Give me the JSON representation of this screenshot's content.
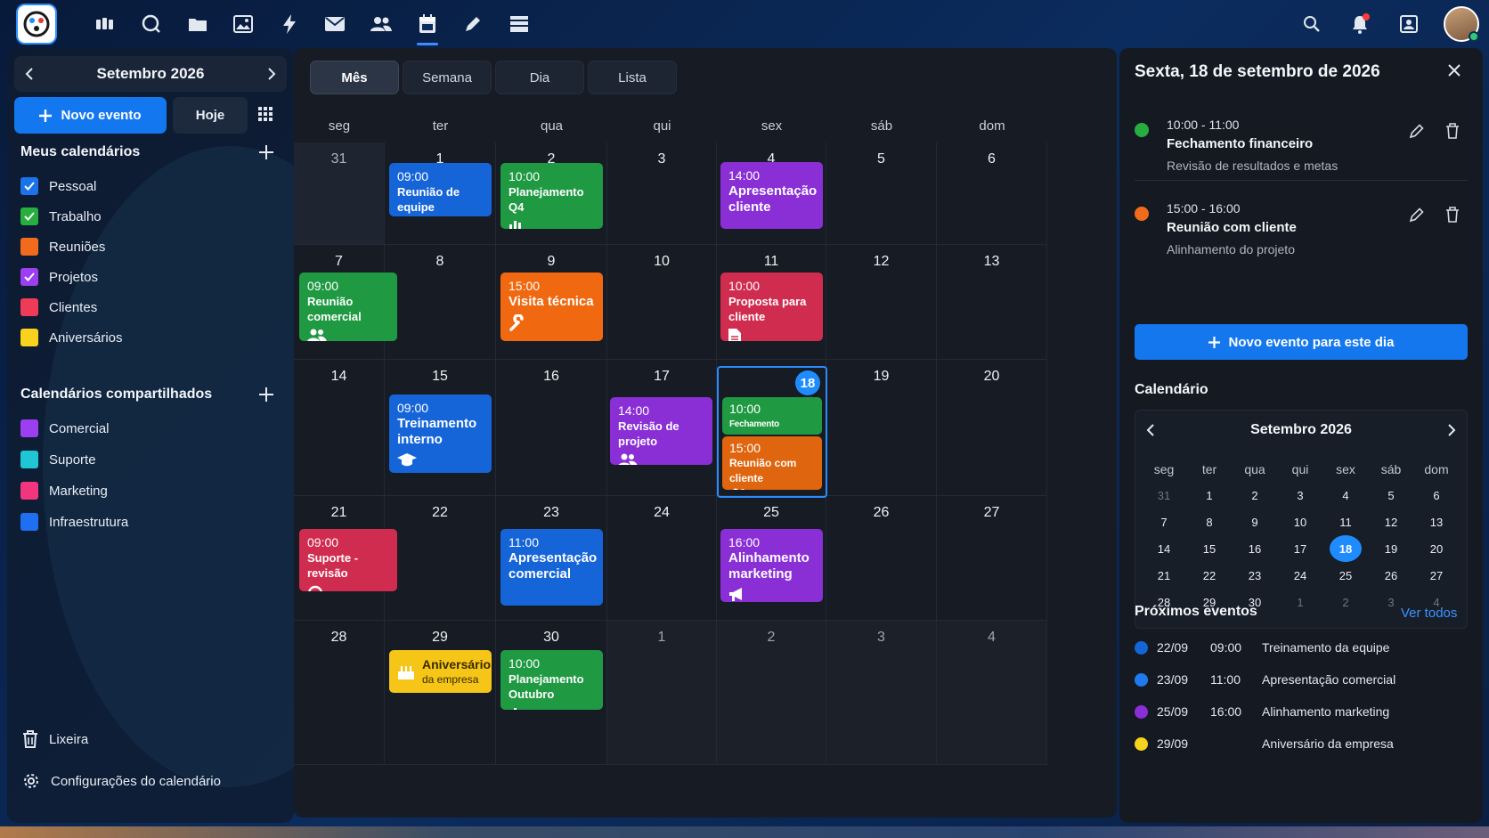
{
  "topbar": {
    "icons": [
      "apps-logo-icon",
      "widgets-icon",
      "chat-icon",
      "folder-icon",
      "image-icon",
      "flash-icon",
      "mail-icon",
      "contacts-icon",
      "calendar-icon",
      "pen-icon",
      "stack-icon"
    ],
    "right_icons": [
      "search-icon",
      "bell-icon",
      "address-book-icon",
      "avatar"
    ]
  },
  "sidebar": {
    "month_label": "Setembro 2026",
    "new_event": "Novo evento",
    "today": "Hoje",
    "my_calendars_title": "Meus calendários",
    "my_calendars": [
      {
        "label": "Pessoal",
        "color": "#1a73e8",
        "checked": true
      },
      {
        "label": "Trabalho",
        "color": "#27ae3f",
        "checked": true
      },
      {
        "label": "Reuniões",
        "color": "#f26b1d",
        "checked": false
      },
      {
        "label": "Projetos",
        "color": "#9b3ff0",
        "checked": true
      },
      {
        "label": "Clientes",
        "color": "#ef3b57",
        "checked": false
      },
      {
        "label": "Aniversários",
        "color": "#f8d21c",
        "checked": false
      }
    ],
    "shared_title": "Calendários compartilhados",
    "shared": [
      {
        "label": "Comercial",
        "color": "#9b3ff0"
      },
      {
        "label": "Suporte",
        "color": "#1fc7d6"
      },
      {
        "label": "Marketing",
        "color": "#f2357e"
      },
      {
        "label": "Infraestrutura",
        "color": "#1f6ff2"
      }
    ],
    "trash": "Lixeira",
    "settings": "Configurações do calendário"
  },
  "main": {
    "tabs": [
      {
        "label": "Mês",
        "active": true
      },
      {
        "label": "Semana"
      },
      {
        "label": "Dia"
      },
      {
        "label": "Lista"
      }
    ],
    "weekdays": [
      "seg",
      "ter",
      "qua",
      "qui",
      "sex",
      "sáb",
      "dom"
    ],
    "weeks": [
      [
        {
          "d": "31",
          "past": true
        },
        {
          "d": "1"
        },
        {
          "d": "2"
        },
        {
          "d": "3"
        },
        {
          "d": "4"
        },
        {
          "d": "5"
        },
        {
          "d": "6"
        }
      ],
      [
        {
          "d": "7"
        },
        {
          "d": "8"
        },
        {
          "d": "9"
        },
        {
          "d": "10"
        },
        {
          "d": "11"
        },
        {
          "d": "12"
        },
        {
          "d": "13"
        }
      ],
      [
        {
          "d": "14"
        },
        {
          "d": "15"
        },
        {
          "d": "16"
        },
        {
          "d": "17"
        },
        {
          "d": "18",
          "today": true
        },
        {
          "d": "19"
        },
        {
          "d": "20"
        }
      ],
      [
        {
          "d": "21"
        },
        {
          "d": "22"
        },
        {
          "d": "23"
        },
        {
          "d": "24"
        },
        {
          "d": "25"
        },
        {
          "d": "26"
        },
        {
          "d": "27"
        }
      ],
      [
        {
          "d": "28"
        },
        {
          "d": "29"
        },
        {
          "d": "30"
        },
        {
          "d": "1",
          "out": true
        },
        {
          "d": "2",
          "out": true
        },
        {
          "d": "3",
          "out": true
        },
        {
          "d": "4",
          "out": true
        }
      ]
    ],
    "events": [
      {
        "w": 0,
        "c": 1,
        "time": "09:00",
        "name": "Reunião de equipe",
        "color": "#1565d8",
        "icon": "",
        "big": false
      },
      {
        "w": 0,
        "c": 2,
        "time": "10:00",
        "name": "Planejamento Q4",
        "color": "#1f9a43",
        "icon": "chart",
        "big": false
      },
      {
        "w": 0,
        "c": 4,
        "time": "14:00",
        "name": "Apresentação cliente",
        "color": "#8a2fd6",
        "icon": "",
        "big": true
      },
      {
        "w": 1,
        "c": 0,
        "time": "09:00",
        "name": "Reunião comercial",
        "color": "#1f9a43",
        "icon": "people",
        "big": false
      },
      {
        "w": 1,
        "c": 2,
        "time": "15:00",
        "name": "Visita técnica",
        "color": "#f0680f",
        "icon": "wrench",
        "big": true
      },
      {
        "w": 1,
        "c": 4,
        "time": "10:00",
        "name": "Proposta para cliente",
        "color": "#d02c4f",
        "icon": "doc",
        "big": false
      },
      {
        "w": 2,
        "c": 1,
        "time": "09:00",
        "name": "Treinamento interno",
        "color": "#1565d8",
        "icon": "grad",
        "big": true
      },
      {
        "w": 2,
        "c": 3,
        "time": "14:00",
        "name": "Revisão de projeto",
        "color": "#8a2fd6",
        "icon": "people",
        "big": false
      },
      {
        "w": 3,
        "c": 0,
        "time": "09:00",
        "name": "Suporte - revisão",
        "color": "#d02c4f",
        "icon": "headset",
        "big": false
      },
      {
        "w": 3,
        "c": 2,
        "time": "11:00",
        "name": "Apresentação comercial",
        "color": "#1565d8",
        "icon": "",
        "big": true
      },
      {
        "w": 3,
        "c": 4,
        "time": "16:00",
        "name": "Alinhamento marketing",
        "color": "#8a2fd6",
        "icon": "megaphone",
        "big": true
      },
      {
        "w": 4,
        "c": 2,
        "time": "10:00",
        "name": "Planejamento Outubro",
        "color": "#1f9a43",
        "icon": "chart",
        "big": false
      }
    ],
    "today_events": [
      {
        "time": "10:00",
        "name": "Fechamento financeiro",
        "color": "#1f9a43"
      },
      {
        "time": "15:00",
        "name": "Reunião com cliente",
        "color": "#e0650f"
      }
    ],
    "birthday": {
      "name": "Aniversário",
      "sub": "da empresa",
      "color": "#f5c518"
    }
  },
  "panel": {
    "title": "Sexta, 18 de setembro de 2026",
    "events": [
      {
        "time": "10:00 - 11:00",
        "name": "Fechamento financeiro",
        "desc": "Revisão de resultados e metas",
        "color": "#27ae3f"
      },
      {
        "time": "15:00 - 16:00",
        "name": "Reunião com cliente",
        "desc": "Alinhamento do projeto",
        "color": "#f26b1d"
      }
    ],
    "new_day_event": "Novo evento para este dia",
    "calendar_title": "Calendário",
    "mini_month": "Setembro 2026",
    "mini_weekdays": [
      "seg",
      "ter",
      "qua",
      "qui",
      "sex",
      "sáb",
      "dom"
    ],
    "mini_weeks": [
      [
        [
          "31",
          1
        ],
        [
          "1",
          0
        ],
        [
          "2",
          0
        ],
        [
          "3",
          0
        ],
        [
          "4",
          0
        ],
        [
          "5",
          0
        ],
        [
          "6",
          0
        ]
      ],
      [
        [
          "7",
          0
        ],
        [
          "8",
          0
        ],
        [
          "9",
          0
        ],
        [
          "10",
          0
        ],
        [
          "11",
          0
        ],
        [
          "12",
          0
        ],
        [
          "13",
          0
        ]
      ],
      [
        [
          "14",
          0
        ],
        [
          "15",
          0
        ],
        [
          "16",
          0
        ],
        [
          "17",
          0
        ],
        [
          "18",
          2
        ],
        [
          "19",
          0
        ],
        [
          "20",
          0
        ]
      ],
      [
        [
          "21",
          0
        ],
        [
          "22",
          0
        ],
        [
          "23",
          0
        ],
        [
          "24",
          0
        ],
        [
          "25",
          0
        ],
        [
          "26",
          0
        ],
        [
          "27",
          0
        ]
      ],
      [
        [
          "28",
          0
        ],
        [
          "29",
          0
        ],
        [
          "30",
          0
        ],
        [
          "1",
          1
        ],
        [
          "2",
          1
        ],
        [
          "3",
          1
        ],
        [
          "4",
          1
        ]
      ]
    ],
    "upcoming_title": "Próximos eventos",
    "see_all": "Ver todos",
    "upcoming": [
      {
        "date": "22/09",
        "hour": "09:00",
        "name": "Treinamento da equipe",
        "color": "#1565d8"
      },
      {
        "date": "23/09",
        "hour": "11:00",
        "name": "Apresentação comercial",
        "color": "#1f7af0"
      },
      {
        "date": "25/09",
        "hour": "16:00",
        "name": "Alinhamento marketing",
        "color": "#8a2fd6"
      },
      {
        "date": "29/09",
        "hour": "",
        "name": "Aniversário da empresa",
        "color": "#f5d21c"
      }
    ]
  }
}
